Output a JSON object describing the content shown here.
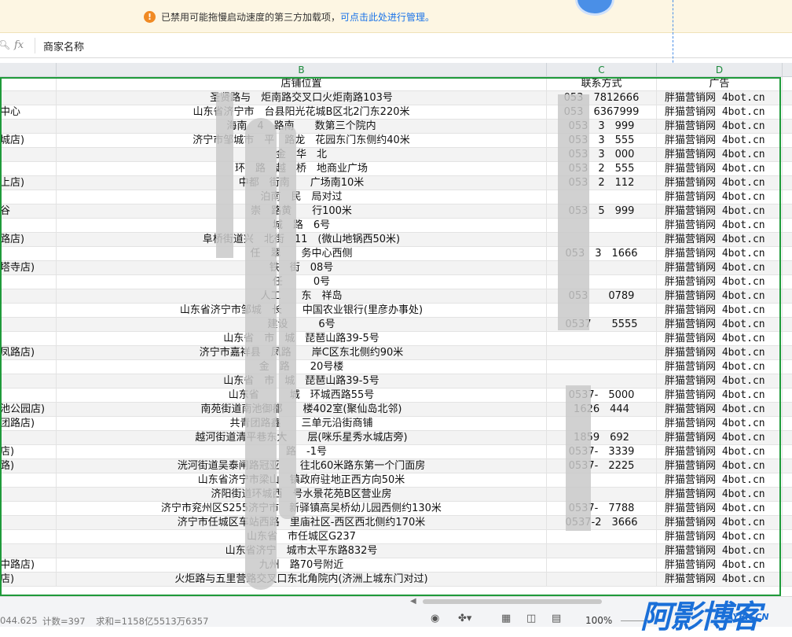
{
  "notice": {
    "icon": "warning-icon",
    "message": "已禁用可能拖慢启动速度的第三方加载项，",
    "link": "可点击此处进行管理。"
  },
  "formula_bar": {
    "name_box_icon": "zoom-icon",
    "fx_label": "fx",
    "content": "商家名称"
  },
  "columns": {
    "b": "B",
    "c": "C",
    "d": "D"
  },
  "header_row": {
    "a": "",
    "b": "店铺位置",
    "c": "联系方式",
    "d": "广告"
  },
  "rows": [
    {
      "a": "",
      "b": "圣贤路与　炬南路交叉口火炬南路103号",
      "c": "053　7812666",
      "d": "胖猫营销网 4bot.cn"
    },
    {
      "a": "中心",
      "b": "山东省济宁市　台县阳光花城B区北2门东220米",
      "c": "053　6367999",
      "d": "胖猫营销网 4bot.cn"
    },
    {
      "a": "",
      "b": "海南　4　路南　　数第三个院内",
      "c": "053　3　999",
      "d": "胖猫营销网 4bot.cn"
    },
    {
      "a": "城店)",
      "b": "济宁市邹城市　平　路龙　花园东门东侧约40米",
      "c": "053　3　555",
      "d": "胖猫营销网 4bot.cn"
    },
    {
      "a": "",
      "b": "金　华　北",
      "c": "053　3　000",
      "d": "胖猫营销网 4bot.cn"
    },
    {
      "a": "",
      "b": "环　路　越　桥　地商业广场",
      "c": "053　2　555",
      "d": "胖猫营销网 4bot.cn"
    },
    {
      "a": "上店)",
      "b": "中都　街南　　广场南10米",
      "c": "053　2　112",
      "d": "胖猫营销网 4bot.cn"
    },
    {
      "a": "",
      "b": "泊南　民　局对过",
      "c": "",
      "d": "胖猫营销网 4bot.cn"
    },
    {
      "a": "谷",
      "b": "崇　路黄　　行100米",
      "c": "053　5　999",
      "d": "胖猫营销网 4bot.cn"
    },
    {
      "a": "",
      "b": "城　路　6号",
      "c": "",
      "d": "胖猫营销网 4bot.cn"
    },
    {
      "a": "路店)",
      "b": "阜桥街道兴　北街　11　(微山地锅西50米)",
      "c": "",
      "d": "胖猫营销网 4bot.cn"
    },
    {
      "a": "",
      "b": "任　翠　　务中心西侧",
      "c": "053　3　1666",
      "d": "胖猫营销网 4bot.cn"
    },
    {
      "a": "塔寺店)",
      "b": "铁　街　08号",
      "c": "",
      "d": "胖猫营销网 4bot.cn"
    },
    {
      "a": "",
      "b": "任　　　0号",
      "c": "",
      "d": "胖猫营销网 4bot.cn"
    },
    {
      "a": "",
      "b": "人工　　东　祥岛",
      "c": "053　　0789",
      "d": "胖猫营销网 4bot.cn"
    },
    {
      "a": "",
      "b": "山东省济宁市邹城　长　　中国农业银行(里彦办事处)",
      "c": "",
      "d": "胖猫营销网 4bot.cn"
    },
    {
      "a": "",
      "b": "建设　　　6号",
      "c": "0537　　5555",
      "d": "胖猫营销网 4bot.cn"
    },
    {
      "a": "",
      "b": "山东省　市　城　琵琶山路39-5号",
      "c": "",
      "d": "胖猫营销网 4bot.cn"
    },
    {
      "a": "凤路店)",
      "b": "济宁市嘉祥县　凤路　　岸C区东北侧约90米",
      "c": "",
      "d": "胖猫营销网 4bot.cn"
    },
    {
      "a": "",
      "b": "金　路　　20号楼",
      "c": "",
      "d": "胖猫营销网 4bot.cn"
    },
    {
      "a": "",
      "b": "山东省　市　城　琵琶山路39-5号",
      "c": "",
      "d": "胖猫营销网 4bot.cn"
    },
    {
      "a": "",
      "b": "山东省　　　城　环城西路55号",
      "c": "0537-　5000",
      "d": "胖猫营销网 4bot.cn"
    },
    {
      "a": "池公园店)",
      "b": "南苑街道南池御都　　楼402室(聚仙岛北邻)",
      "c": "1626　444",
      "d": "胖猫营销网 4bot.cn"
    },
    {
      "a": "团路店)",
      "b": "共青团路鑫　　三单元沿街商铺",
      "c": "",
      "d": "胖猫营销网 4bot.cn"
    },
    {
      "a": "",
      "b": "越河街道清平巷东大　　层(咪乐星秀水城店旁)",
      "c": "1859　692",
      "d": "胖猫营销网 4bot.cn"
    },
    {
      "a": "店)",
      "b": "　路　-1号",
      "c": "0537-　3339",
      "d": "胖猫营销网 4bot.cn"
    },
    {
      "a": "路)",
      "b": "洸河街道吴泰闸路冠亚　　往北60米路东第一个门面房",
      "c": "0537-　2225",
      "d": "胖猫营销网 4bot.cn"
    },
    {
      "a": "",
      "b": "山东省济宁市梁山　镇政府驻地正西方向50米",
      "c": "",
      "d": "胖猫营销网 4bot.cn"
    },
    {
      "a": "",
      "b": "济阳街道环城西　号水景花苑B区营业房",
      "c": "",
      "d": "胖猫营销网 4bot.cn"
    },
    {
      "a": "",
      "b": "济宁市兖州区S255济宁市　新驿镇高吴桥幼儿园西侧约130米",
      "c": "0537-　7788",
      "d": "胖猫营销网 4bot.cn"
    },
    {
      "a": "",
      "b": "济宁市任城区车站西路　里庙社区-西区西北侧约170米",
      "c": "0537-2　3666",
      "d": "胖猫营销网 4bot.cn"
    },
    {
      "a": "",
      "b": "山东省　市任城区G237",
      "c": "",
      "d": "胖猫营销网 4bot.cn"
    },
    {
      "a": "",
      "b": "山东省济宁　城市太平东路832号",
      "c": "",
      "d": "胖猫营销网 4bot.cn"
    },
    {
      "a": "中路店)",
      "b": "九州　路70号附近",
      "c": "",
      "d": "胖猫营销网 4bot.cn"
    },
    {
      "a": "店)",
      "b": "火炬路与五里营路交叉口东北角院内(济洲上城东门对过)",
      "c": "",
      "d": "胖猫营销网 4bot.cn"
    }
  ],
  "status_bar": {
    "sum_left": "044.625",
    "count": "计数=397",
    "sum": "求和=1158亿5513万6357",
    "zoom": "100%",
    "icons": [
      "eye-icon",
      "cell-style-icon",
      "normal-view-icon",
      "page-layout-icon",
      "page-break-icon"
    ]
  },
  "watermark": {
    "main": "阿影博客",
    "sub": "AYBK.CN"
  },
  "colors": {
    "accent": "#1f9a3a",
    "link": "#1a73e8",
    "warning": "#f08a24"
  }
}
